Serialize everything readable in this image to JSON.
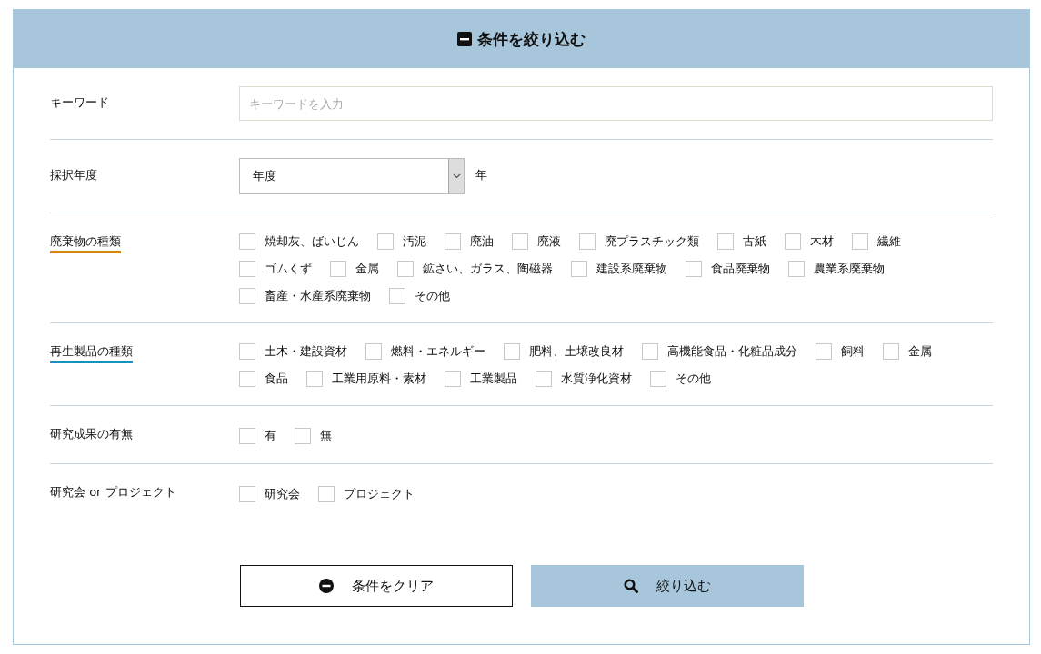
{
  "header": {
    "title": "条件を絞り込む"
  },
  "sections": [
    {
      "kind": "text",
      "label": "キーワード",
      "placeholder": "キーワードを入力"
    },
    {
      "kind": "select",
      "label": "採択年度",
      "value": "年度",
      "suffix": "年"
    },
    {
      "kind": "checkboxes",
      "label": "廃棄物の種類",
      "color": "#d4860b",
      "options": [
        {
          "label": "焼却灰、ばいじん",
          "checked": false
        },
        {
          "label": "汚泥",
          "checked": false
        },
        {
          "label": "廃油",
          "checked": false
        },
        {
          "label": "廃液",
          "checked": false
        },
        {
          "label": "廃プラスチック類",
          "checked": false
        },
        {
          "label": "古紙",
          "checked": false
        },
        {
          "label": "木材",
          "checked": false
        },
        {
          "label": "繊維",
          "checked": false
        },
        {
          "label": "ゴムくず",
          "checked": false
        },
        {
          "label": "金属",
          "checked": false
        },
        {
          "label": "鉱さい、ガラス、陶磁器",
          "checked": false
        },
        {
          "label": "建設系廃棄物",
          "checked": false
        },
        {
          "label": "食品廃棄物",
          "checked": false
        },
        {
          "label": "農業系廃棄物",
          "checked": false
        },
        {
          "label": "畜産・水産系廃棄物",
          "checked": false
        },
        {
          "label": "その他",
          "checked": false
        }
      ]
    },
    {
      "kind": "checkboxes",
      "label": "再生製品の種類",
      "color": "#1a8fc6",
      "options": [
        {
          "label": "土木・建設資材",
          "checked": false
        },
        {
          "label": "燃料・エネルギー",
          "checked": false
        },
        {
          "label": "肥料、土壌改良材",
          "checked": false
        },
        {
          "label": "高機能食品・化粧品成分",
          "checked": false
        },
        {
          "label": "飼料",
          "checked": false
        },
        {
          "label": "金属",
          "checked": false
        },
        {
          "label": "食品",
          "checked": false
        },
        {
          "label": "工業用原料・素材",
          "checked": false
        },
        {
          "label": "工業製品",
          "checked": false
        },
        {
          "label": "水質浄化資材",
          "checked": false
        },
        {
          "label": "その他",
          "checked": false
        }
      ]
    },
    {
      "kind": "checkboxes",
      "label": "研究成果の有無",
      "options": [
        {
          "label": "有",
          "checked": false
        },
        {
          "label": "無",
          "checked": false
        }
      ]
    },
    {
      "kind": "checkboxes",
      "label": "研究会 or プロジェクト",
      "options": [
        {
          "label": "研究会",
          "checked": false
        },
        {
          "label": "プロジェクト",
          "checked": false
        }
      ]
    }
  ],
  "buttons": [
    {
      "kind": "clear",
      "label": "条件をクリア"
    },
    {
      "kind": "search",
      "label": "絞り込む"
    }
  ]
}
